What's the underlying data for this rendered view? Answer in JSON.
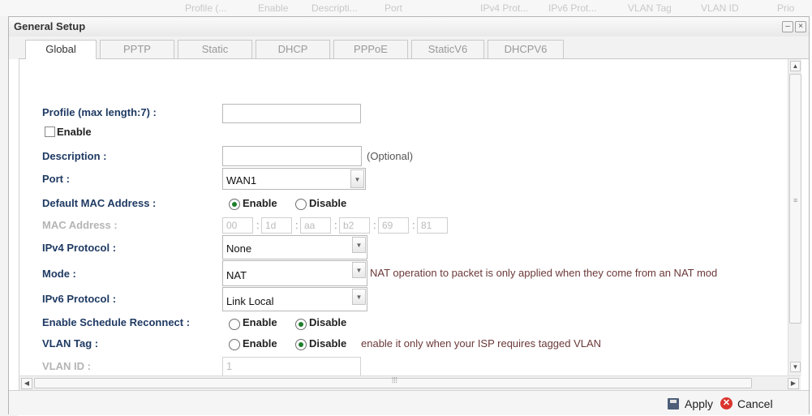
{
  "background_header": {
    "columns": [
      "Profile (...",
      "Enable",
      "Descripti...",
      "Port",
      "IPv4 Prot...",
      "IPv6 Prot...",
      "VLAN Tag",
      "VLAN ID",
      "Prio"
    ]
  },
  "dialog": {
    "title": "General Setup",
    "min_icon": "–",
    "close_icon": "×"
  },
  "tabs": [
    {
      "label": "Global",
      "active": true
    },
    {
      "label": "PPTP",
      "active": false
    },
    {
      "label": "Static",
      "active": false
    },
    {
      "label": "DHCP",
      "active": false
    },
    {
      "label": "PPPoE",
      "active": false
    },
    {
      "label": "StaticV6",
      "active": false
    },
    {
      "label": "DHCPV6",
      "active": false
    }
  ],
  "form": {
    "profile_label": "Profile (max length:7) :",
    "profile_value": "",
    "enable_checkbox_label": "Enable",
    "description_label": "Description :",
    "description_value": "",
    "description_hint": "(Optional)",
    "port_label": "Port :",
    "port_value": "WAN1",
    "default_mac_label": "Default MAC Address :",
    "default_mac_enable": "Enable",
    "default_mac_disable": "Disable",
    "mac_label": "MAC Address :",
    "mac_octets": [
      "00",
      "1d",
      "aa",
      "b2",
      "69",
      "81"
    ],
    "mac_separator": ":",
    "ipv4_label": "IPv4 Protocol :",
    "ipv4_value": "None",
    "mode_label": "Mode :",
    "mode_value": "NAT",
    "mode_note": "NAT operation to packet is only applied when they come from an NAT mod",
    "ipv6_label": "IPv6 Protocol :",
    "ipv6_value": "Link Local",
    "schedule_label": "Enable Schedule Reconnect :",
    "schedule_enable": "Enable",
    "schedule_disable": "Disable",
    "vlan_tag_label": "VLAN Tag :",
    "vlan_tag_enable": "Enable",
    "vlan_tag_disable": "Disable",
    "vlan_tag_note": "enable it only when your ISP requires tagged VLAN",
    "vlan_id_label": "VLAN ID :",
    "vlan_id_value": "1"
  },
  "footer": {
    "apply_label": "Apply",
    "cancel_label": "Cancel"
  },
  "colors": {
    "label_blue": "#1f3a63",
    "radio_selected": "#1e7f2b",
    "cancel_red": "#d9342c"
  }
}
